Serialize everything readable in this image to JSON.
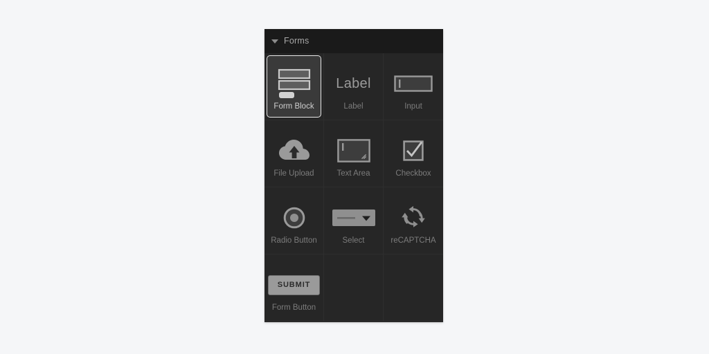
{
  "panel": {
    "title": "Forms",
    "caret_icon": "chevron-down-icon",
    "colors": {
      "page_background": "#f5f6f8",
      "panel_background": "#262626",
      "header_background": "#1a1a1a",
      "divider": "#2e2e2e",
      "label_text": "#7c7c7c",
      "selected_label_text": "#cfcfcf",
      "selected_border": "#e9e9e9",
      "selected_background": "#3a3a3a",
      "icon_gray": "#9a9a9a"
    }
  },
  "items": [
    {
      "label": "Form Block",
      "icon": "form-block-icon",
      "selected": true
    },
    {
      "label": "Label",
      "icon": "label-icon",
      "selected": false,
      "glyph_text": "Label"
    },
    {
      "label": "Input",
      "icon": "input-field-icon",
      "selected": false
    },
    {
      "label": "File Upload",
      "icon": "cloud-upload-icon",
      "selected": false
    },
    {
      "label": "Text Area",
      "icon": "text-area-icon",
      "selected": false
    },
    {
      "label": "Checkbox",
      "icon": "checkbox-icon",
      "selected": false
    },
    {
      "label": "Radio Button",
      "icon": "radio-button-icon",
      "selected": false
    },
    {
      "label": "Select",
      "icon": "select-dropdown-icon",
      "selected": false
    },
    {
      "label": "reCAPTCHA",
      "icon": "recaptcha-icon",
      "selected": false
    },
    {
      "label": "Form Button",
      "icon": "submit-button-icon",
      "selected": false,
      "glyph_text": "SUBMIT"
    }
  ]
}
